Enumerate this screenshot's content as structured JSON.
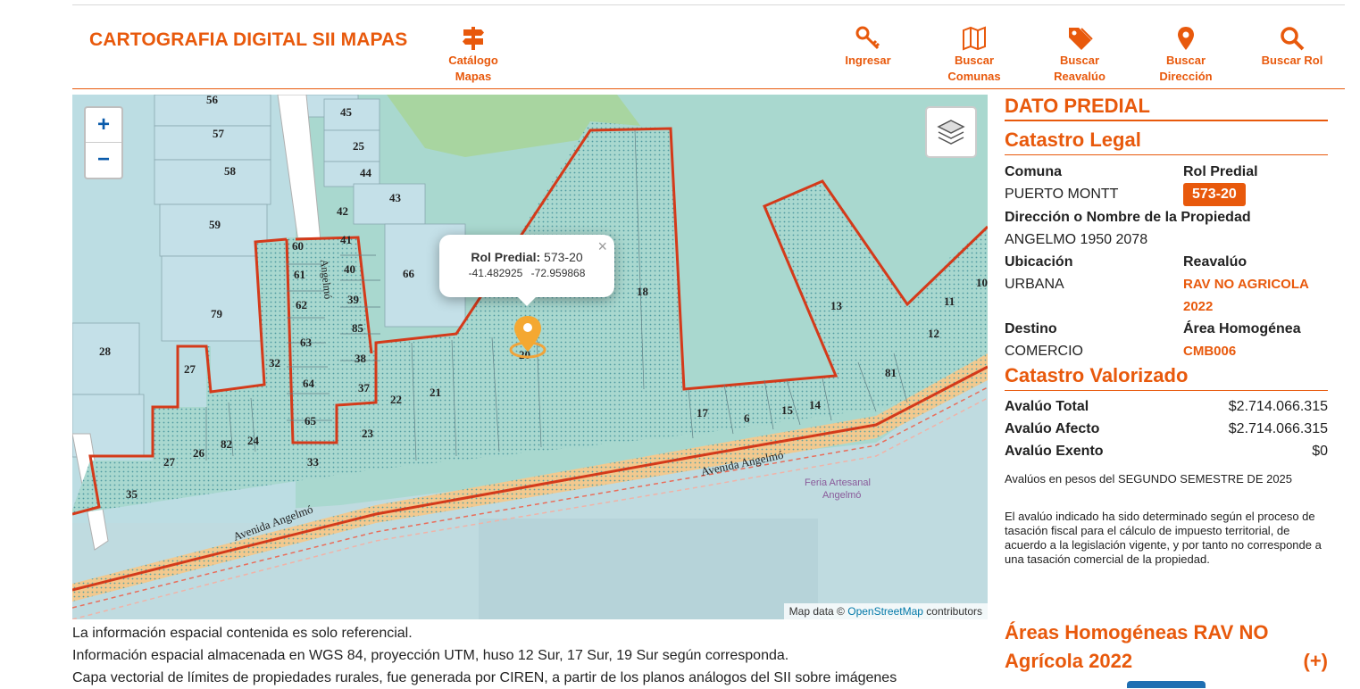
{
  "header": {
    "title": "CARTOGRAFIA DIGITAL SII MAPAS",
    "nav": [
      {
        "label": "Catálogo\nMapas",
        "icon": "signpost-icon"
      },
      {
        "label": "Ingresar",
        "icon": "key-icon"
      },
      {
        "label": "Buscar\nComunas",
        "icon": "map-icon"
      },
      {
        "label": "Buscar\nReavalúo",
        "icon": "tag-icon"
      },
      {
        "label": "Buscar\nDirección",
        "icon": "location-pin-icon"
      },
      {
        "label": "Buscar Rol",
        "icon": "search-icon"
      }
    ]
  },
  "map": {
    "zoom_in": "+",
    "zoom_out": "−",
    "popup": {
      "label": "Rol Predial:",
      "value": "573-20",
      "coords": "-41.482925   -72.959868",
      "close": "×"
    },
    "attribution": {
      "prefix": "Map data ©",
      "link": "OpenStreetMap",
      "suffix": "contributors"
    },
    "street_labels": [
      "Angelmó",
      "Avenida Angelmó",
      "Avenida Angelmó",
      "Feria Artesanal",
      "Angelmó"
    ],
    "lot_numbers": [
      "56",
      "57",
      "58",
      "59",
      "79",
      "28",
      "27",
      "27",
      "26",
      "82",
      "24",
      "32",
      "35",
      "60",
      "61",
      "62",
      "63",
      "64",
      "65",
      "33",
      "45",
      "25",
      "44",
      "43",
      "42",
      "41",
      "40",
      "39",
      "85",
      "38",
      "37",
      "23",
      "22",
      "21",
      "66",
      "18",
      "17",
      "6",
      "15",
      "14",
      "81",
      "12",
      "11",
      "13",
      "10",
      "20"
    ]
  },
  "notes": [
    "La información espacial contenida es solo referencial.",
    "Información espacial almacenada en WGS 84, proyección UTM, huso 12 Sur, 17 Sur, 19 Sur según corresponda.",
    "Capa vectorial de límites de propiedades rurales, fue generada por CIREN, a partir de los planos análogos del SII sobre imágenes"
  ],
  "panel": {
    "title": "DATO PREDIAL",
    "legal": {
      "heading": "Catastro Legal",
      "comuna_label": "Comuna",
      "comuna": "PUERTO MONTT",
      "rol_label": "Rol Predial",
      "rol": "573-20",
      "direccion_label": "Dirección o Nombre de la Propiedad",
      "direccion": "ANGELMO 1950 2078",
      "ubicacion_label": "Ubicación",
      "ubicacion": "URBANA",
      "reavaluo_label": "Reavalúo",
      "reavaluo": "RAV NO AGRICOLA 2022",
      "destino_label": "Destino",
      "destino": "COMERCIO",
      "area_label": "Área Homogénea",
      "area": "CMB006"
    },
    "valorizado": {
      "heading": "Catastro Valorizado",
      "rows": [
        {
          "label": "Avalúo Total",
          "value": "$2.714.066.315"
        },
        {
          "label": "Avalúo Afecto",
          "value": "$2.714.066.315"
        },
        {
          "label": "Avalúo Exento",
          "value": "$0"
        }
      ],
      "note1": "Avalúos en pesos del SEGUNDO SEMESTRE DE 2025",
      "note2": "El avalúo indicado ha sido determinado según el proceso de tasación fiscal para el cálculo de impuesto territorial, de acuerdo a la legislación vigente, y por tanto no corresponde a una tasación comercial de la propiedad."
    },
    "areas_heading": "Áreas Homogéneas RAV NO Agrícola 2022",
    "areas_toggle": "(+)"
  },
  "colors": {
    "accent": "#e8590c",
    "parcel_border": "#d43a1a",
    "water": "#bfdbe0",
    "land": "#a9d8cf"
  }
}
